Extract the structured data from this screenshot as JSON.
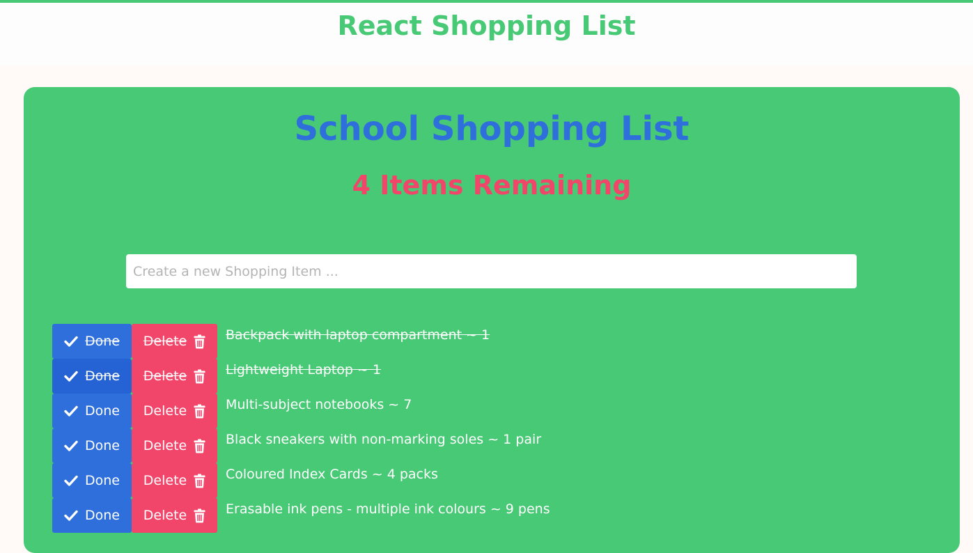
{
  "header": {
    "title": "React Shopping List"
  },
  "list": {
    "title": "School Shopping List",
    "remaining": "4 Items Remaining",
    "input_placeholder": "Create a new Shopping Item ...",
    "done_label": "Done",
    "delete_label": "Delete",
    "items": [
      {
        "text": "Backpack with laptop compartment ~ 1",
        "done": true
      },
      {
        "text": "Lightweight Laptop ~ 1",
        "done": true
      },
      {
        "text": "Multi-subject notebooks ~ 7",
        "done": false
      },
      {
        "text": "Black sneakers with non-marking soles ~ 1 pair",
        "done": false
      },
      {
        "text": "Coloured Index Cards ~ 4 packs",
        "done": false
      },
      {
        "text": "Erasable ink pens - multiple ink colours ~ 9 pens",
        "done": false
      }
    ]
  },
  "icons": {
    "done": "check-icon",
    "delete": "trash-icon"
  },
  "colors": {
    "green": "#48c975",
    "blue": "#2f6fdc",
    "red": "#f1456a"
  }
}
